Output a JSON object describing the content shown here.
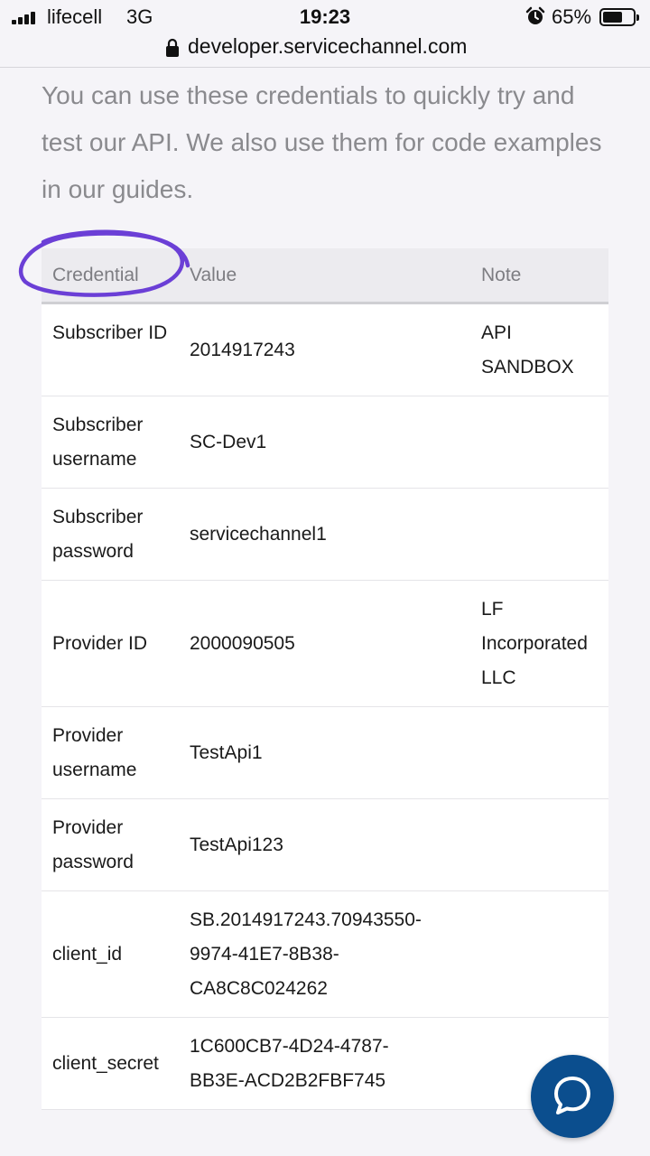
{
  "status_bar": {
    "carrier": "lifecell",
    "network": "3G",
    "time": "19:23",
    "battery_pct": "65%",
    "battery_level": 0.65,
    "icons": [
      "signal-icon",
      "alarm-icon",
      "battery-icon"
    ]
  },
  "browser": {
    "url": "developer.servicechannel.com",
    "icons": [
      "lock-icon"
    ]
  },
  "intro": {
    "text": "You can use these credentials to quickly try and test our API. We also use them for code examples in our guides."
  },
  "table": {
    "headers": [
      "Credential",
      "Value",
      "Note"
    ],
    "rows": [
      {
        "credential": "Subscriber ID",
        "value": "2014917243",
        "note": "API SANDBOX"
      },
      {
        "credential": "Subscriber username",
        "value": "SC-Dev1",
        "note": ""
      },
      {
        "credential": "Subscriber password",
        "value": "servicechannel1",
        "note": ""
      },
      {
        "credential": "Provider ID",
        "value": "2000090505",
        "note": "LF Incorporated LLC"
      },
      {
        "credential": "Provider username",
        "value": "TestApi1",
        "note": ""
      },
      {
        "credential": "Provider password",
        "value": "TestApi123",
        "note": ""
      },
      {
        "credential": "client_id",
        "value": "SB.2014917243.70943550-9974-41E7-8B38-CA8C8C024262",
        "note": ""
      },
      {
        "credential": "client_secret",
        "value": "1C600CB7-4D24-4787-BB3E-ACD2B2FBF745",
        "note": ""
      }
    ]
  },
  "colors": {
    "accent": "#0b4e8e",
    "annotation": "#6b3fd6",
    "muted_text": "#8a8a8e"
  },
  "chat": {
    "icon": "chat-bubble-icon"
  }
}
